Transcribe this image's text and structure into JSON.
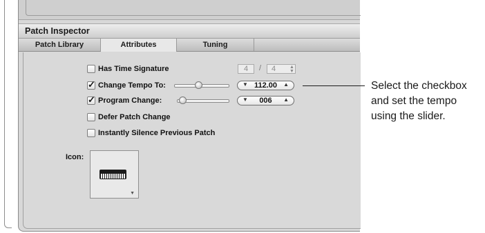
{
  "inspector": {
    "title": "Patch Inspector",
    "tabs": [
      {
        "label": "Patch Library",
        "active": false
      },
      {
        "label": "Attributes",
        "active": true
      },
      {
        "label": "Tuning",
        "active": false
      }
    ]
  },
  "attributes": {
    "has_time_signature": {
      "label": "Has Time Signature",
      "checked": false,
      "numerator": "4",
      "separator": "/",
      "denominator": "4"
    },
    "change_tempo": {
      "label": "Change Tempo To:",
      "checked": true,
      "value": "112.00",
      "slider_position": 0.45
    },
    "program_change": {
      "label": "Program Change:",
      "checked": true,
      "value": "006",
      "slider_position": 0.05
    },
    "defer_patch_change": {
      "label": "Defer Patch Change",
      "checked": false
    },
    "instantly_silence": {
      "label": "Instantly Silence Previous Patch",
      "checked": false
    },
    "icon_label": "Icon:",
    "icon_name": "keyboard-icon"
  },
  "callout": {
    "lines": [
      "Select the checkbox",
      "and set the tempo",
      "using the slider."
    ]
  }
}
